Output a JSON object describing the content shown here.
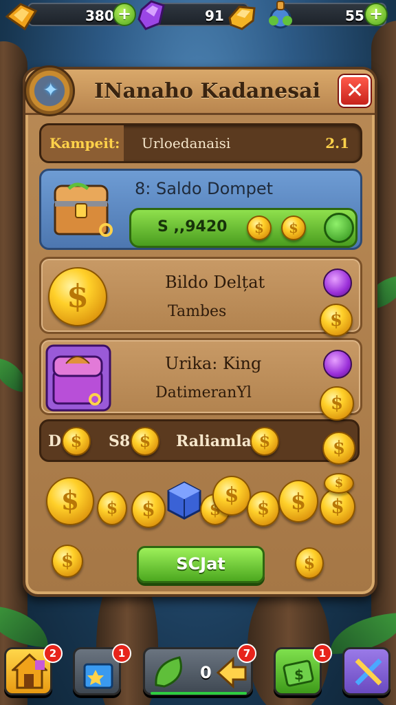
{
  "topbar": {
    "gold": {
      "value": "380"
    },
    "gems": {
      "value": "91"
    },
    "energy": {
      "value": "55"
    }
  },
  "dialog": {
    "title": "INanaho Kadanesai",
    "close_label": "✕",
    "kampeit": {
      "label": "Kampeit:",
      "value": "Urloedanaisi",
      "number": "2.1"
    },
    "saldo": {
      "title": "8: Saldo Dompet",
      "amount": "S ,,9420"
    },
    "card1": {
      "title": "Bildo Delțat",
      "subtitle": "Tambes"
    },
    "card2": {
      "title": "Urika: King",
      "subtitle": "DatimeranYl"
    },
    "bar": {
      "d": "D",
      "s": "S8",
      "r": "Raliamlart"
    },
    "button_label": "SCJat"
  },
  "bottom_nav": {
    "home": {
      "badge": "2"
    },
    "shop": {
      "badge": "1"
    },
    "center": {
      "value": "0",
      "badge": "7"
    },
    "cash": {
      "badge": "1"
    }
  },
  "colors": {
    "panel": "#b98a55",
    "accent_green": "#4ca81f",
    "close_red": "#d42a20",
    "badge_red": "#e7241b"
  }
}
